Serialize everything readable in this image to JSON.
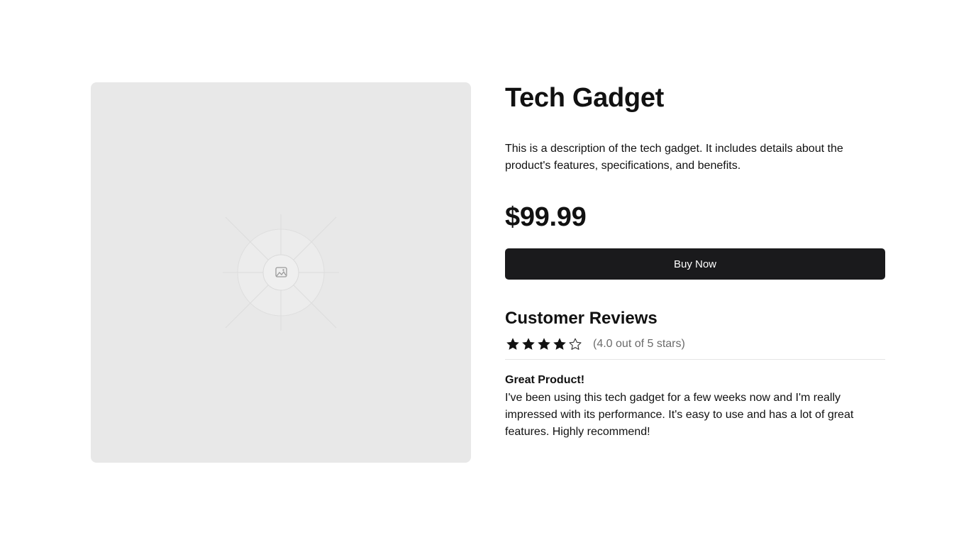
{
  "product": {
    "title": "Tech Gadget",
    "description": "This is a description of the tech gadget. It includes details about the product's features, specifications, and benefits.",
    "price": "$99.99",
    "buy_label": "Buy Now",
    "image_icon": "image-placeholder-icon"
  },
  "reviews": {
    "heading": "Customer Reviews",
    "rating_value": 4.0,
    "rating_max": 5,
    "rating_text": "(4.0 out of 5 stars)",
    "items": [
      {
        "title": "Great Product!",
        "body": "I've been using this tech gadget for a few weeks now and I'm really impressed with its performance. It's easy to use and has a lot of great features. Highly recommend!"
      }
    ]
  },
  "colors": {
    "button_bg": "#1a1a1c",
    "image_bg": "#e8e8e8",
    "star_filled": "#111111",
    "muted_text": "#6b6b6b"
  }
}
